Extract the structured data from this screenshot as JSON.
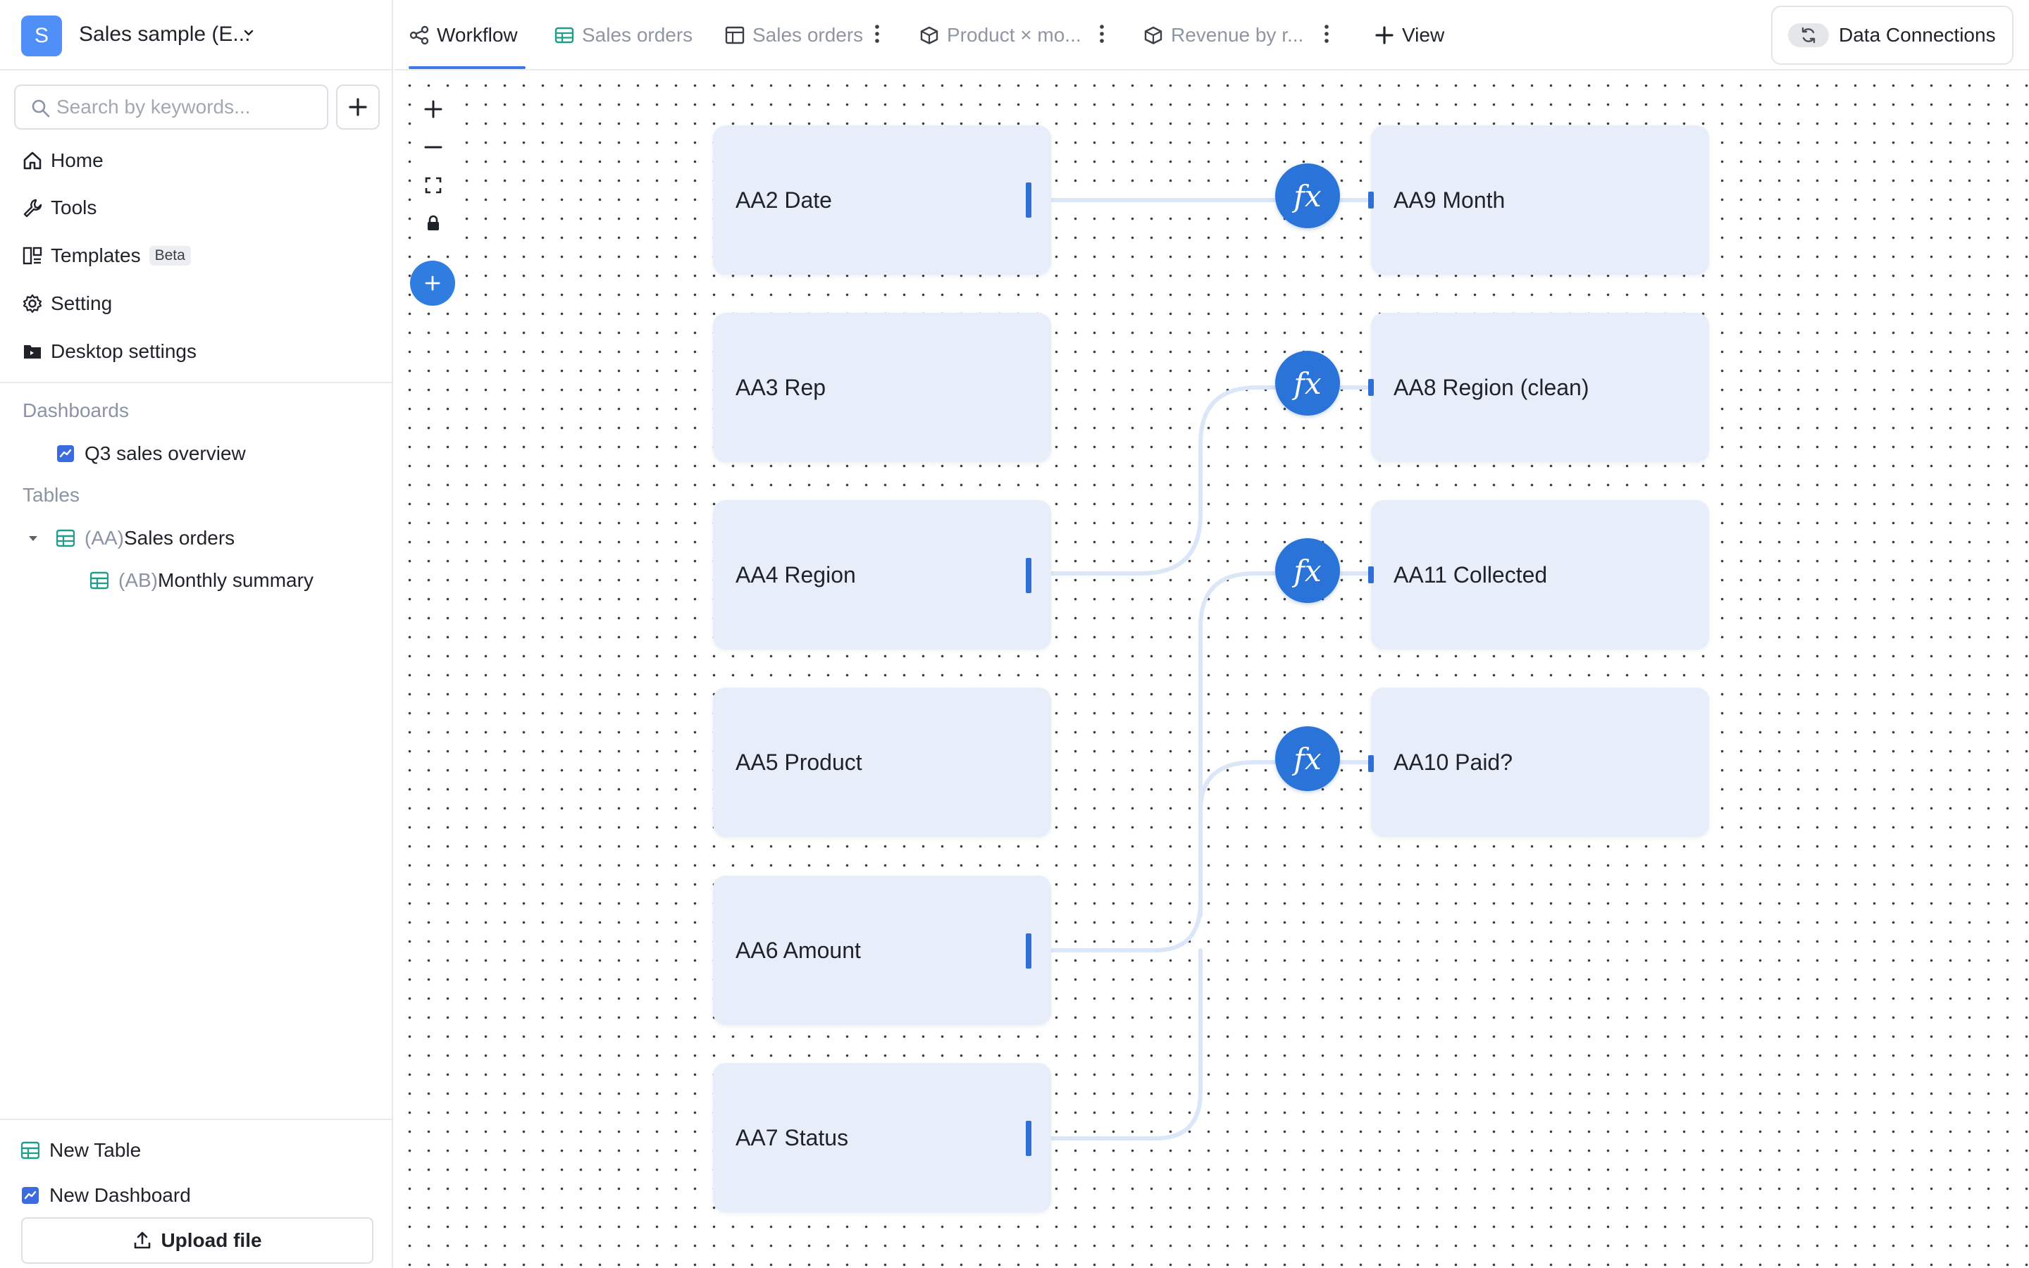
{
  "workspace": {
    "avatar_letter": "S",
    "name": "Sales sample (E..."
  },
  "search": {
    "placeholder": "Search by keywords..."
  },
  "nav": {
    "home": "Home",
    "tools": "Tools",
    "templates": "Templates",
    "templates_badge": "Beta",
    "setting": "Setting",
    "desktop_settings": "Desktop settings"
  },
  "dashboards": {
    "title": "Dashboards",
    "items": [
      "Q3 sales overview"
    ]
  },
  "tables": {
    "title": "Tables",
    "items": [
      {
        "prefix": "(AA)",
        "name": "Sales orders"
      },
      {
        "prefix": "(AB)",
        "name": "Monthly summary"
      }
    ]
  },
  "footer": {
    "new_table": "New Table",
    "new_dashboard": "New Dashboard",
    "upload": "Upload file"
  },
  "tabs": [
    "Workflow",
    "Sales orders",
    "Sales orders",
    "Product × mo...",
    "Revenue by r..."
  ],
  "add_view": "View",
  "data_connections": "Data Connections",
  "source_nodes": [
    "AA2 Date",
    "AA3 Rep",
    "AA4 Region",
    "AA5 Product",
    "AA6 Amount",
    "AA7 Status"
  ],
  "target_nodes": [
    "AA9 Month",
    "AA8 Region (clean)",
    "AA11 Collected",
    "AA10 Paid?"
  ],
  "fx_label": "fx",
  "colors": {
    "accent": "#2a74d9",
    "node_bg": "#e8eef9",
    "edge": "#dbe6f6",
    "muted_text": "#8f96a3"
  }
}
